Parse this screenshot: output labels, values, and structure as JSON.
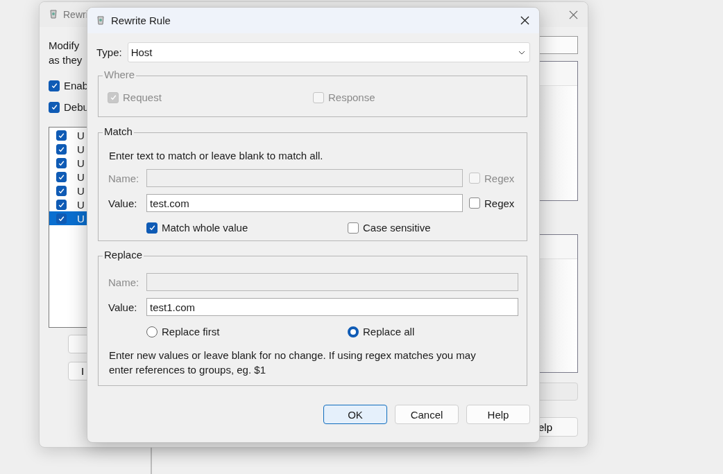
{
  "back_window": {
    "title": "Rewri",
    "intro": [
      "Modify",
      "as they"
    ],
    "options": [
      {
        "label": "Enab",
        "checked": true
      },
      {
        "label": "Debu",
        "checked": true
      }
    ],
    "rules": [
      {
        "label": "U",
        "checked": true,
        "selected": false
      },
      {
        "label": "U",
        "checked": true,
        "selected": false
      },
      {
        "label": "U",
        "checked": true,
        "selected": false
      },
      {
        "label": "U",
        "checked": true,
        "selected": false
      },
      {
        "label": "U",
        "checked": true,
        "selected": false
      },
      {
        "label": "U",
        "checked": true,
        "selected": false
      },
      {
        "label": "U",
        "checked": true,
        "selected": true
      }
    ],
    "left_button": "I",
    "right_button": "elp"
  },
  "dialog": {
    "title": "Rewrite Rule",
    "type_label": "Type:",
    "type_value": "Host",
    "where": {
      "legend": "Where",
      "options": [
        {
          "label": "Request",
          "checked": true,
          "disabled": true
        },
        {
          "label": "Response",
          "checked": false,
          "disabled": true
        }
      ]
    },
    "match": {
      "legend": "Match",
      "hint": "Enter text to match or leave blank to match all.",
      "fields": [
        {
          "label": "Name:",
          "disabled": true,
          "regex": {
            "label": "Regex",
            "checked": false,
            "disabled": true
          }
        },
        {
          "label": "Value:",
          "value": "test.com",
          "disabled": false,
          "regex": {
            "label": "Regex",
            "checked": false,
            "disabled": false
          }
        }
      ],
      "options": [
        {
          "label": "Match whole value",
          "checked": true
        },
        {
          "label": "Case sensitive",
          "checked": false
        }
      ]
    },
    "replace": {
      "legend": "Replace",
      "fields": [
        {
          "label": "Name:",
          "disabled": true
        },
        {
          "label": "Value:",
          "value": "test1.com",
          "disabled": false
        }
      ],
      "modes": [
        {
          "label": "Replace first",
          "selected": false
        },
        {
          "label": "Replace all",
          "selected": true
        }
      ],
      "note": "Enter new values or leave blank for no change. If using regex matches you may enter references to groups, eg. $1"
    },
    "buttons": [
      {
        "label": "OK",
        "default": true
      },
      {
        "label": "Cancel",
        "default": false
      },
      {
        "label": "Help",
        "default": false
      }
    ]
  }
}
